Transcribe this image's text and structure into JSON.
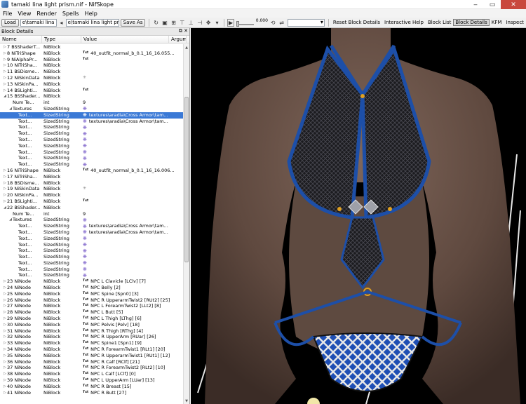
{
  "window": {
    "title": "tamaki lina light prism.nif - NifSkope"
  },
  "menu": [
    "File",
    "View",
    "Render",
    "Spells",
    "Help"
  ],
  "toolbar": {
    "load_label": "Load",
    "load_path": "e\\tamaki lina light prism.nif",
    "save_path": "e\\tamaki lina light prism.nif",
    "save_label": "Save As",
    "time_value": "0.000",
    "links": [
      "Reset Block Details",
      "Interactive Help",
      "Block List",
      "Block Details",
      "KFM",
      "Inspect"
    ],
    "active_link": "Block Details"
  },
  "panel": {
    "title": "Block Details",
    "columns": [
      "Name",
      "Type",
      "Value",
      "Argume"
    ]
  },
  "rows": [
    {
      "arrow": "▷",
      "indent": 0,
      "name": "7 BSShaderT...",
      "type": "NiBlock",
      "icon": "",
      "value": ""
    },
    {
      "arrow": "▷",
      "indent": 0,
      "name": "8 NiTriShape",
      "type": "NiBlock",
      "icon": "txt",
      "value": "40_outfit_normal_b_0.1_16_16.055..."
    },
    {
      "arrow": "▷",
      "indent": 0,
      "name": "9 NiAlphaPr...",
      "type": "NiBlock",
      "icon": "txt",
      "value": ""
    },
    {
      "arrow": "▷",
      "indent": 0,
      "name": "10 NiTriSha...",
      "type": "NiBlock",
      "icon": "",
      "value": ""
    },
    {
      "arrow": "▷",
      "indent": 0,
      "name": "11 BSDisme...",
      "type": "NiBlock",
      "icon": "",
      "value": ""
    },
    {
      "arrow": "▷",
      "indent": 0,
      "name": "12 NiSkinData",
      "type": "NiBlock",
      "icon": "gray",
      "value": ""
    },
    {
      "arrow": "▷",
      "indent": 0,
      "name": "13 NiSkinPa...",
      "type": "NiBlock",
      "icon": "",
      "value": ""
    },
    {
      "arrow": "▷",
      "indent": 0,
      "name": "14 BSLighti...",
      "type": "NiBlock",
      "icon": "txt",
      "value": ""
    },
    {
      "arrow": "◢",
      "indent": 0,
      "name": "15 BSShader...",
      "type": "NiBlock",
      "icon": "",
      "value": ""
    },
    {
      "arrow": "",
      "indent": 2,
      "name": "Num Te...",
      "type": "int",
      "icon": "",
      "value": "9"
    },
    {
      "arrow": "◢",
      "indent": 2,
      "name": "Textures",
      "type": "SizedString",
      "icon": "star",
      "value": ""
    },
    {
      "arrow": "",
      "indent": 4,
      "name": "Text...",
      "type": "SizedString",
      "icon": "star",
      "value": "textures\\aradia\\Cross Armor\\tam...",
      "sel": true
    },
    {
      "arrow": "",
      "indent": 4,
      "name": "Text...",
      "type": "SizedString",
      "icon": "star",
      "value": "textures\\aradia\\Cross Armor\\tam..."
    },
    {
      "arrow": "",
      "indent": 4,
      "name": "Text...",
      "type": "SizedString",
      "icon": "star",
      "value": ""
    },
    {
      "arrow": "",
      "indent": 4,
      "name": "Text...",
      "type": "SizedString",
      "icon": "star",
      "value": ""
    },
    {
      "arrow": "",
      "indent": 4,
      "name": "Text...",
      "type": "SizedString",
      "icon": "star",
      "value": ""
    },
    {
      "arrow": "",
      "indent": 4,
      "name": "Text...",
      "type": "SizedString",
      "icon": "star",
      "value": ""
    },
    {
      "arrow": "",
      "indent": 4,
      "name": "Text...",
      "type": "SizedString",
      "icon": "star",
      "value": ""
    },
    {
      "arrow": "",
      "indent": 4,
      "name": "Text...",
      "type": "SizedString",
      "icon": "star",
      "value": ""
    },
    {
      "arrow": "",
      "indent": 4,
      "name": "Text...",
      "type": "SizedString",
      "icon": "star",
      "value": ""
    },
    {
      "arrow": "▷",
      "indent": 0,
      "name": "16 NiTriShape",
      "type": "NiBlock",
      "icon": "txt",
      "value": "40_outfit_normal_b_0.1_16_16.006..."
    },
    {
      "arrow": "▷",
      "indent": 0,
      "name": "17 NiTriSha...",
      "type": "NiBlock",
      "icon": "",
      "value": ""
    },
    {
      "arrow": "▷",
      "indent": 0,
      "name": "18 BSDisme...",
      "type": "NiBlock",
      "icon": "",
      "value": ""
    },
    {
      "arrow": "▷",
      "indent": 0,
      "name": "19 NiSkinData",
      "type": "NiBlock",
      "icon": "gray",
      "value": ""
    },
    {
      "arrow": "▷",
      "indent": 0,
      "name": "20 NiSkinPa...",
      "type": "NiBlock",
      "icon": "",
      "value": ""
    },
    {
      "arrow": "▷",
      "indent": 0,
      "name": "21 BSLighti...",
      "type": "NiBlock",
      "icon": "txt",
      "value": ""
    },
    {
      "arrow": "◢",
      "indent": 0,
      "name": "22 BSShader...",
      "type": "NiBlock",
      "icon": "",
      "value": ""
    },
    {
      "arrow": "",
      "indent": 2,
      "name": "Num Te...",
      "type": "int",
      "icon": "",
      "value": "9"
    },
    {
      "arrow": "◢",
      "indent": 2,
      "name": "Textures",
      "type": "SizedString",
      "icon": "star",
      "value": ""
    },
    {
      "arrow": "",
      "indent": 4,
      "name": "Text...",
      "type": "SizedString",
      "icon": "star",
      "value": "textures\\aradia\\Cross Armor\\tam..."
    },
    {
      "arrow": "",
      "indent": 4,
      "name": "Text...",
      "type": "SizedString",
      "icon": "star",
      "value": "textures\\aradia\\Cross Armor\\tam..."
    },
    {
      "arrow": "",
      "indent": 4,
      "name": "Text...",
      "type": "SizedString",
      "icon": "star",
      "value": ""
    },
    {
      "arrow": "",
      "indent": 4,
      "name": "Text...",
      "type": "SizedString",
      "icon": "star",
      "value": ""
    },
    {
      "arrow": "",
      "indent": 4,
      "name": "Text...",
      "type": "SizedString",
      "icon": "star",
      "value": ""
    },
    {
      "arrow": "",
      "indent": 4,
      "name": "Text...",
      "type": "SizedString",
      "icon": "star",
      "value": ""
    },
    {
      "arrow": "",
      "indent": 4,
      "name": "Text...",
      "type": "SizedString",
      "icon": "star",
      "value": ""
    },
    {
      "arrow": "",
      "indent": 4,
      "name": "Text...",
      "type": "SizedString",
      "icon": "star",
      "value": ""
    },
    {
      "arrow": "",
      "indent": 4,
      "name": "Text...",
      "type": "SizedString",
      "icon": "star",
      "value": ""
    },
    {
      "arrow": "▷",
      "indent": 0,
      "name": "23 NiNode",
      "type": "NiBlock",
      "icon": "txt",
      "value": "NPC L Clavicle [LClv] [7]"
    },
    {
      "arrow": "▷",
      "indent": 0,
      "name": "24 NiNode",
      "type": "NiBlock",
      "icon": "txt",
      "value": "NPC Belly [2]"
    },
    {
      "arrow": "▷",
      "indent": 0,
      "name": "25 NiNode",
      "type": "NiBlock",
      "icon": "txt",
      "value": "NPC Spine [Spn0] [3]"
    },
    {
      "arrow": "▷",
      "indent": 0,
      "name": "26 NiNode",
      "type": "NiBlock",
      "icon": "txt",
      "value": "NPC R UpperarmTwist2 [RUt2] [25]"
    },
    {
      "arrow": "▷",
      "indent": 0,
      "name": "27 NiNode",
      "type": "NiBlock",
      "icon": "txt",
      "value": "NPC L ForearmTwist2 [LLt2] [8]"
    },
    {
      "arrow": "▷",
      "indent": 0,
      "name": "28 NiNode",
      "type": "NiBlock",
      "icon": "txt",
      "value": "NPC L Butt [5]"
    },
    {
      "arrow": "▷",
      "indent": 0,
      "name": "29 NiNode",
      "type": "NiBlock",
      "icon": "txt",
      "value": "NPC L Thigh [LThg] [6]"
    },
    {
      "arrow": "▷",
      "indent": 0,
      "name": "30 NiNode",
      "type": "NiBlock",
      "icon": "txt",
      "value": "NPC Pelvis [Pelv] [18]"
    },
    {
      "arrow": "▷",
      "indent": 0,
      "name": "31 NiNode",
      "type": "NiBlock",
      "icon": "txt",
      "value": "NPC R Thigh [RThg] [4]"
    },
    {
      "arrow": "▷",
      "indent": 0,
      "name": "32 NiNode",
      "type": "NiBlock",
      "icon": "txt",
      "value": "NPC R UpperArm [RUar] [26]"
    },
    {
      "arrow": "▷",
      "indent": 0,
      "name": "33 NiNode",
      "type": "NiBlock",
      "icon": "txt",
      "value": "NPC Spine1 [Spn1] [9]"
    },
    {
      "arrow": "▷",
      "indent": 0,
      "name": "34 NiNode",
      "type": "NiBlock",
      "icon": "txt",
      "value": "NPC R ForearmTwist1 [RLt1] [20]"
    },
    {
      "arrow": "▷",
      "indent": 0,
      "name": "35 NiNode",
      "type": "NiBlock",
      "icon": "txt",
      "value": "NPC R UpperarmTwist1 [RUt1] [12]"
    },
    {
      "arrow": "▷",
      "indent": 0,
      "name": "36 NiNode",
      "type": "NiBlock",
      "icon": "txt",
      "value": "NPC R Calf [RClf] [21]"
    },
    {
      "arrow": "▷",
      "indent": 0,
      "name": "37 NiNode",
      "type": "NiBlock",
      "icon": "txt",
      "value": "NPC R ForearmTwist2 [RLt2] [10]"
    },
    {
      "arrow": "▷",
      "indent": 0,
      "name": "38 NiNode",
      "type": "NiBlock",
      "icon": "txt",
      "value": "NPC L Calf [LClf] [0]"
    },
    {
      "arrow": "▷",
      "indent": 0,
      "name": "39 NiNode",
      "type": "NiBlock",
      "icon": "txt",
      "value": "NPC L UpperArm [LUar] [13]"
    },
    {
      "arrow": "▷",
      "indent": 0,
      "name": "40 NiNode",
      "type": "NiBlock",
      "icon": "txt",
      "value": "NPC R Breast [15]"
    },
    {
      "arrow": "▷",
      "indent": 0,
      "name": "41 NiNode",
      "type": "NiBlock",
      "icon": "txt",
      "value": "NPC R Butt [27]"
    }
  ],
  "icons": {
    "txt": "Txt",
    "star": "❋",
    "gray": "✳"
  },
  "colors": {
    "selection": "#3a79d6",
    "outfit_blue": "#1d4fa8",
    "skin": "#6b5346",
    "viewport_bg": "#000000"
  }
}
